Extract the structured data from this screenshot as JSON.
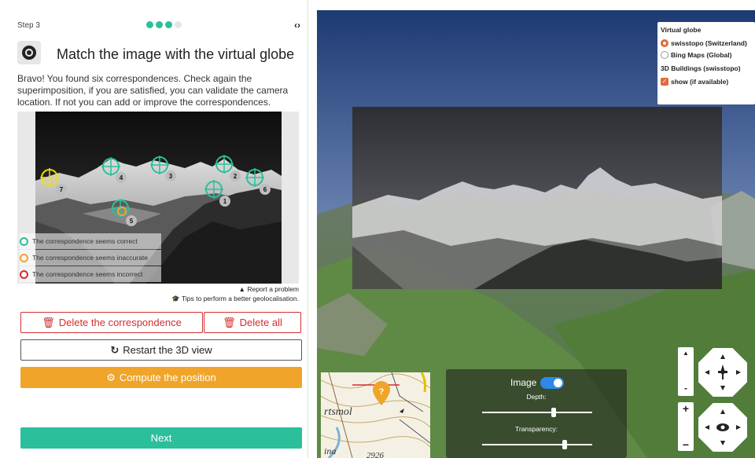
{
  "step": {
    "label": "Step 3",
    "total": 4,
    "current": 3,
    "nav_icon": "code-arrows-icon"
  },
  "title": {
    "text": "Match the image with the virtual globe",
    "icon": "target-icon"
  },
  "description": "Bravo! You found six correspondences. Check again the superimposition, if you are satisfied, you can validate the camera location. If not you can add or improve the correspondences.",
  "legend": [
    {
      "label": "The correspondence seems correct",
      "color": "#2bbf9b"
    },
    {
      "label": "The correspondence seems inaccurate",
      "color": "#f0a52a"
    },
    {
      "label": "The correspondence seems incorrect",
      "color": "#d32f2f"
    }
  ],
  "markers": [
    {
      "label": "1",
      "status": "correct"
    },
    {
      "label": "2",
      "status": "correct"
    },
    {
      "label": "3",
      "status": "correct"
    },
    {
      "label": "4",
      "status": "correct"
    },
    {
      "label": "5",
      "status": "inaccurate"
    },
    {
      "label": "6",
      "status": "correct"
    },
    {
      "label": "7",
      "status": "selected"
    }
  ],
  "links": {
    "report": "Report a problem",
    "tips": "Tips to perform a better geolocalisation."
  },
  "buttons": {
    "delete_correspondence": "Delete the correspondence",
    "delete_all": "Delete all",
    "restart": "Restart the 3D view",
    "compute": "Compute the position",
    "next": "Next"
  },
  "globe_panel": {
    "title": "Virtual globe",
    "options": [
      {
        "label": "swisstopo (Switzerland)",
        "selected": true
      },
      {
        "label": "Bing Maps (Global)",
        "selected": false
      }
    ],
    "buildings_title": "3D Buildings (swisstopo)",
    "buildings_option": {
      "label": "show (if available)",
      "checked": true
    }
  },
  "image_controls": {
    "image_label": "Image",
    "image_toggle_on": true,
    "depth_label": "Depth:",
    "depth_value": 0.66,
    "transparency_label": "Transparency:",
    "transparency_value": 0.76
  },
  "minimap": {
    "text_1": "rtsmol",
    "text_2": "2926",
    "text_3": "ina"
  },
  "colors": {
    "accent_green": "#2bbf9b",
    "accent_orange": "#f0a52a",
    "danger_red": "#d32f2f",
    "globe_radio": "#e06b3a"
  }
}
